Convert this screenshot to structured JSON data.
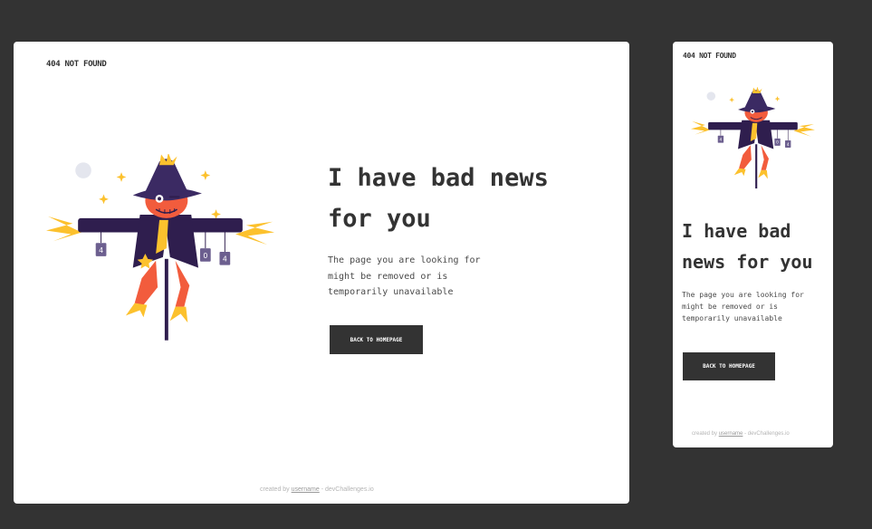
{
  "brand": "404 NOT FOUND",
  "headline": "I have bad news for you",
  "description": "The page you are looking for might be removed or is temporarily unavailable",
  "button_label": "BACK TO HOMEPAGE",
  "footer": {
    "prefix": "created by",
    "username": "username",
    "suffix": "- devChallenges.io"
  },
  "tags": [
    "4",
    "0",
    "4"
  ],
  "colors": {
    "background": "#333333",
    "card": "#ffffff",
    "text": "#333333",
    "coat": "#2f1e4e",
    "face": "#f25c3d",
    "straw": "#fcc12d"
  }
}
